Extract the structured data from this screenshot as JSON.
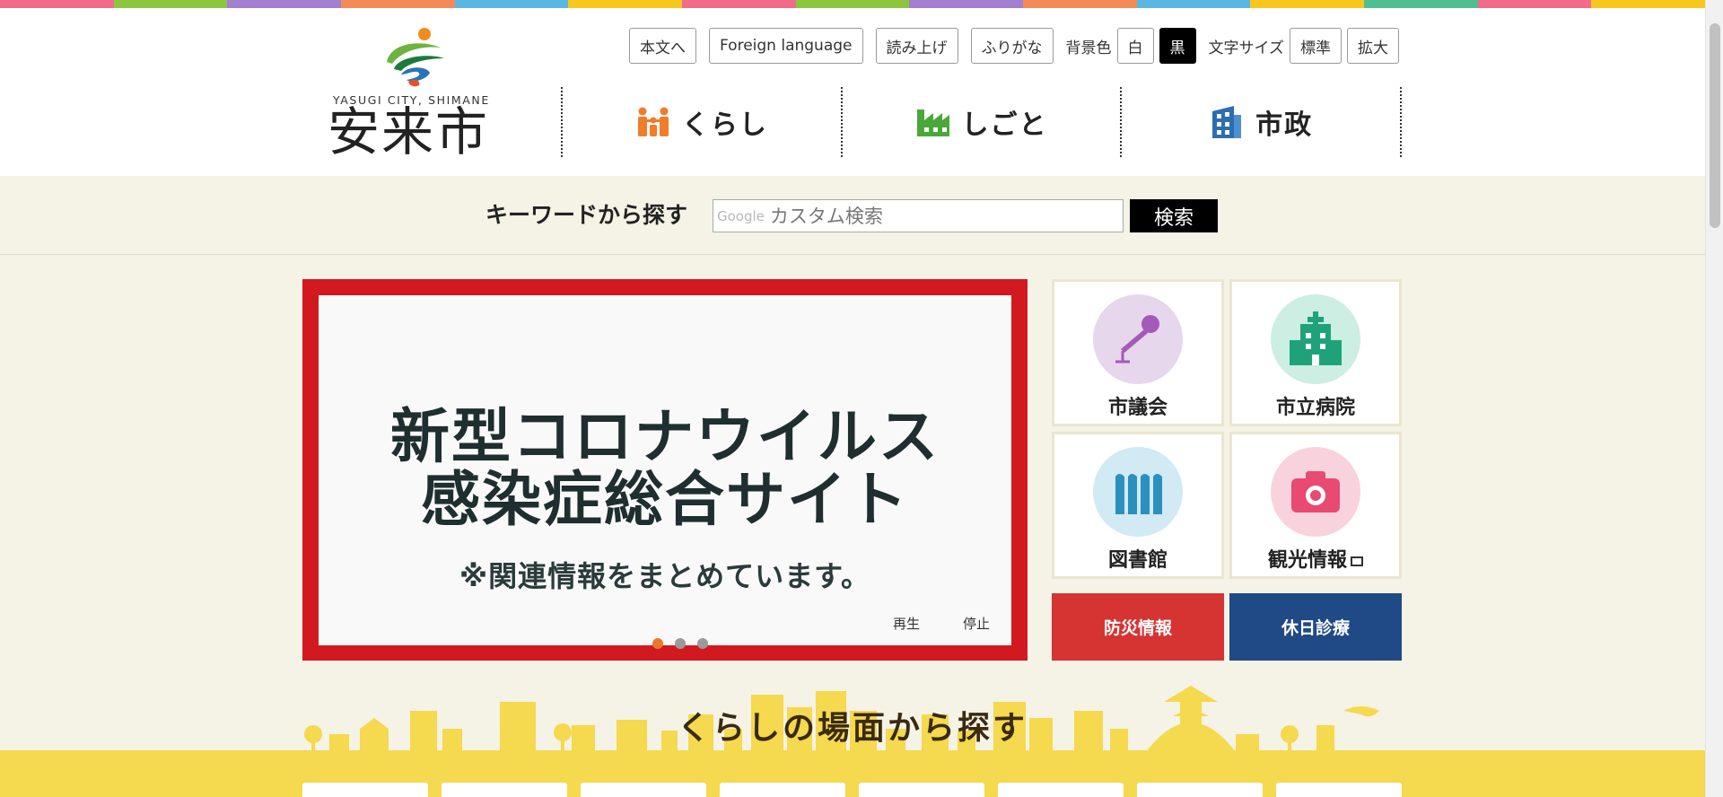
{
  "colors": {
    "strip": [
      "#f06c8a",
      "#8cc63e",
      "#a37fd0",
      "#f38b58",
      "#5bb6e3",
      "#f7c71d",
      "#f06c8a",
      "#8cc63e",
      "#a37fd0",
      "#f38b58",
      "#5bb6e3",
      "#f7c71d",
      "#4fbf8f",
      "#f06c8a",
      "#f7c71d"
    ],
    "banner_border": "#d31920",
    "bosai": "#d53433",
    "kyujitsu": "#204a85",
    "section_yellow": "#f5d94e"
  },
  "header": {
    "logo_caption": "YASUGI CITY, SHIMANE",
    "logo_name": "安来市"
  },
  "util": {
    "skip_to_content": "本文へ",
    "foreign_language": "Foreign language",
    "read_aloud": "読み上げ",
    "furigana": "ふりがな",
    "bg_color_label": "背景色",
    "bg_white": "白",
    "bg_black": "黒",
    "font_size_label": "文字サイズ",
    "font_standard": "標準",
    "font_large": "拡大"
  },
  "nav": {
    "kurashi": "くらし",
    "shigoto": "しごと",
    "shisei": "市政"
  },
  "search": {
    "label": "キーワードから探す",
    "google_mark": "Google",
    "placeholder": "カスタム検索",
    "button": "検索"
  },
  "banner": {
    "title_line1": "新型コロナウイルス",
    "title_line2": "感染症総合サイト",
    "note": "※関連情報をまとめています。",
    "play": "再生",
    "stop": "停止",
    "slide_count": 3,
    "active_slide": 1
  },
  "tiles": {
    "council": "市議会",
    "hospital": "市立病院",
    "library": "図書館",
    "tourism": "観光情報"
  },
  "actions": {
    "bosai": "防災情報",
    "kyujitsu": "休日診療"
  },
  "section": {
    "title": "くらしの場面から探す"
  }
}
